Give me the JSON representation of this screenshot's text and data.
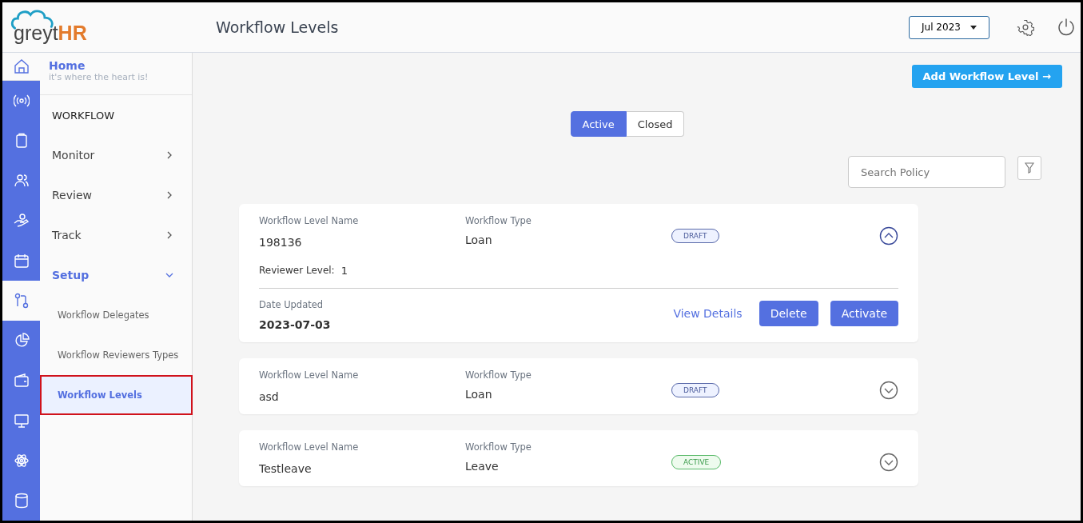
{
  "logo": {
    "text": "greyt",
    "accent": "HR"
  },
  "header": {
    "title": "Workflow Levels",
    "month": "Jul 2023"
  },
  "home": {
    "title": "Home",
    "subtitle": "it's where the heart is!"
  },
  "rail": [
    {
      "selected": false
    },
    {
      "selected": false
    },
    {
      "selected": false
    },
    {
      "selected": false
    },
    {
      "selected": false
    },
    {
      "selected": true
    },
    {
      "selected": false
    },
    {
      "selected": false
    },
    {
      "selected": false
    },
    {
      "selected": false
    },
    {
      "selected": false
    }
  ],
  "nav": {
    "heading": "WORKFLOW",
    "items": [
      {
        "label": "Monitor",
        "expanded": false
      },
      {
        "label": "Review",
        "expanded": false
      },
      {
        "label": "Track",
        "expanded": false
      },
      {
        "label": "Setup",
        "expanded": true,
        "children": [
          {
            "label": "Workflow Delegates",
            "selected": false
          },
          {
            "label": "Workflow Reviewers Types",
            "selected": false
          },
          {
            "label": "Workflow Levels",
            "selected": true
          }
        ]
      }
    ]
  },
  "add_button": "Add Workflow Level →",
  "tabs": [
    {
      "label": "Active",
      "selected": true
    },
    {
      "label": "Closed",
      "selected": false
    }
  ],
  "search": {
    "placeholder": "Search Policy"
  },
  "cards": [
    {
      "name_label": "Workflow Level Name",
      "name": "198136",
      "type_label": "Workflow Type",
      "type": "Loan",
      "status": "DRAFT",
      "kind": "draft",
      "expanded": true,
      "reviewer_label": "Reviewer Level:",
      "reviewer_level": "1",
      "date_label": "Date Updated",
      "date": "2023-07-03",
      "actions": [
        "View Details",
        "Delete",
        "Activate"
      ]
    },
    {
      "name_label": "Workflow Level Name",
      "name": "asd",
      "type_label": "Workflow Type",
      "type": "Loan",
      "status": "DRAFT",
      "kind": "draft",
      "expanded": false
    },
    {
      "name_label": "Workflow Level Name",
      "name": "Testleave",
      "type_label": "Workflow Type",
      "type": "Leave",
      "status": "ACTIVE",
      "kind": "active",
      "expanded": false
    }
  ]
}
